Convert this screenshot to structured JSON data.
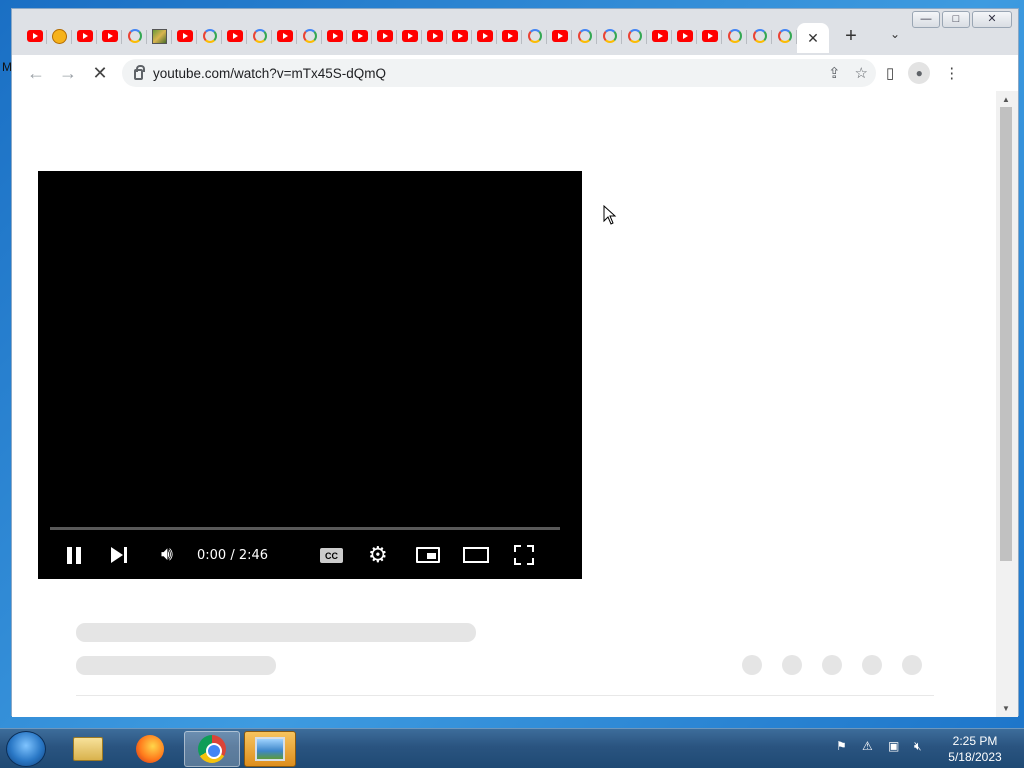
{
  "desktop": {
    "label": "M"
  },
  "browser": {
    "tabs": [
      {
        "icon": "youtube"
      },
      {
        "icon": "emoji"
      },
      {
        "icon": "youtube"
      },
      {
        "icon": "youtube"
      },
      {
        "icon": "google"
      },
      {
        "icon": "image"
      },
      {
        "icon": "youtube"
      },
      {
        "icon": "google"
      },
      {
        "icon": "youtube"
      },
      {
        "icon": "google"
      },
      {
        "icon": "youtube"
      },
      {
        "icon": "google"
      },
      {
        "icon": "youtube"
      },
      {
        "icon": "youtube"
      },
      {
        "icon": "youtube"
      },
      {
        "icon": "youtube"
      },
      {
        "icon": "youtube"
      },
      {
        "icon": "youtube"
      },
      {
        "icon": "youtube"
      },
      {
        "icon": "youtube"
      },
      {
        "icon": "google"
      },
      {
        "icon": "youtube"
      },
      {
        "icon": "google"
      },
      {
        "icon": "google"
      },
      {
        "icon": "google"
      },
      {
        "icon": "youtube"
      },
      {
        "icon": "youtube"
      },
      {
        "icon": "youtube"
      },
      {
        "icon": "google"
      },
      {
        "icon": "google"
      },
      {
        "icon": "google"
      }
    ],
    "active_tab_close": "✕",
    "new_tab": "+",
    "tab_search": "⌄",
    "window_controls": {
      "minimize": "—",
      "maximize": "□",
      "close": "✕"
    },
    "address": "youtube.com/watch?v=mTx45S-dQmQ",
    "nav": {
      "back": "←",
      "forward": "→",
      "stop": "✕"
    }
  },
  "player": {
    "time_display": "0:00 / 2:46",
    "progress": 0.0,
    "cc_label": "CC"
  },
  "taskbar": {
    "apps": [
      "explorer",
      "firefox",
      "chrome",
      "photo-viewer"
    ],
    "clock_time": "2:25 PM",
    "clock_date": "5/18/2023"
  },
  "colors": {
    "youtube_red": "#ff0000",
    "player_bg": "#000000",
    "skeleton": "#e5e5e5"
  }
}
